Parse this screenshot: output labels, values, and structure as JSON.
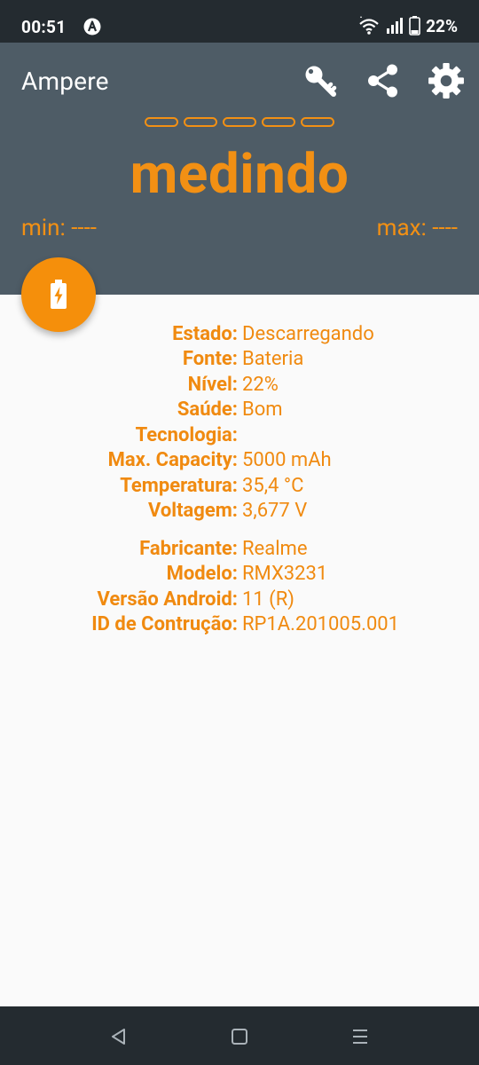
{
  "status_bar": {
    "time": "00:51",
    "battery_percent": "22%",
    "icons": [
      "a-circle-icon",
      "wifi-icon",
      "signal-icon",
      "battery-icon"
    ]
  },
  "app_bar": {
    "title": "Ampere",
    "actions": [
      "key-icon",
      "share-icon",
      "gear-icon"
    ],
    "dash_count": 5,
    "measurement": "medindo",
    "min": "min: ----",
    "max": "max: ----"
  },
  "fab": {
    "icon": "battery-charging-icon"
  },
  "battery_info": [
    {
      "label": "Estado:",
      "value": "Descarregando"
    },
    {
      "label": "Fonte:",
      "value": "Bateria"
    },
    {
      "label": "Nível:",
      "value": "22%"
    },
    {
      "label": "Saúde:",
      "value": "Bom"
    },
    {
      "label": "Tecnologia:",
      "value": ""
    },
    {
      "label": "Max. Capacity:",
      "value": "5000 mAh"
    },
    {
      "label": "Temperatura:",
      "value": "35,4 °C"
    },
    {
      "label": "Voltagem:",
      "value": "3,677 V"
    }
  ],
  "device_info": [
    {
      "label": "Fabricante:",
      "value": "Realme"
    },
    {
      "label": "Modelo:",
      "value": "RMX3231"
    },
    {
      "label": "Versão Android:",
      "value": "11 (R)"
    },
    {
      "label": "ID de Contrução:",
      "value": "RP1A.201005.001"
    }
  ],
  "colors": {
    "accent": "#f29014",
    "app_bar_bg": "#4e5c66",
    "system_bar_bg": "#242b30",
    "content_bg": "#fafafa"
  },
  "nav_bar": [
    "back-icon",
    "home-icon",
    "recents-icon"
  ]
}
